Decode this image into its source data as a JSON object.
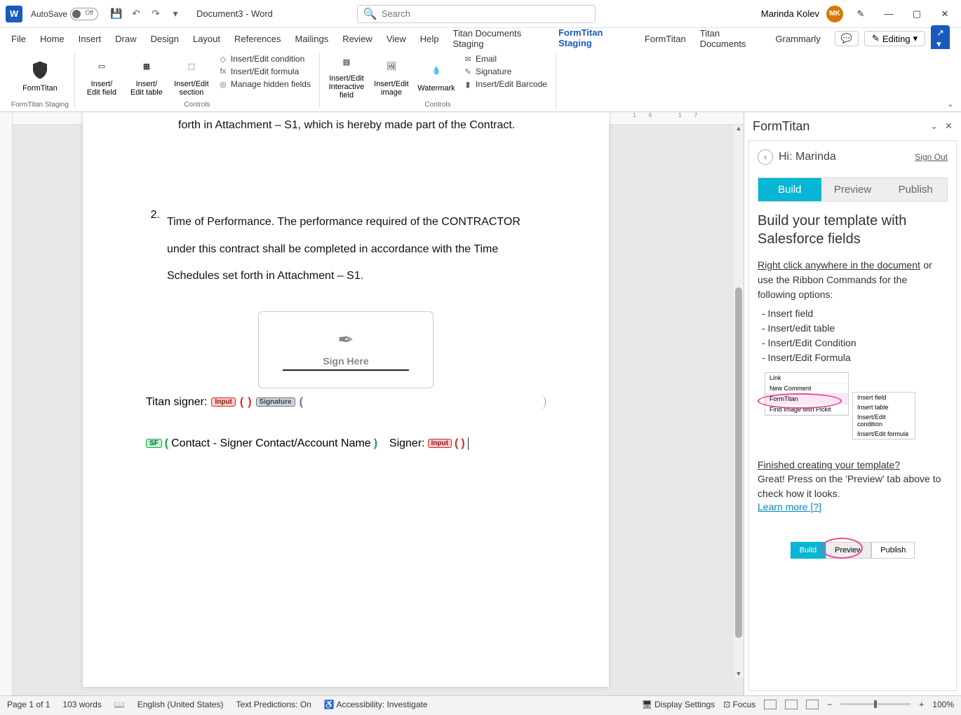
{
  "titlebar": {
    "autosave_label": "AutoSave",
    "autosave_state": "Off",
    "doc_title": "Document3  -  Word",
    "search_placeholder": "Search",
    "username": "Marinda Kolev",
    "avatar_initials": "MK",
    "editing_label": "Editing"
  },
  "tabs": {
    "items": [
      "File",
      "Home",
      "Insert",
      "Draw",
      "Design",
      "Layout",
      "References",
      "Mailings",
      "Review",
      "View",
      "Help",
      "Titan Documents Staging",
      "FormTitan Staging",
      "FormTitan",
      "Titan Documents",
      "Grammarly"
    ],
    "active": "FormTitan Staging"
  },
  "ribbon": {
    "group1_label": "FormTitan Staging",
    "group1_btn": "FormTitan",
    "group2_label": "Controls",
    "group2_btns": [
      "Insert/\nEdit field",
      "Insert/\nEdit table",
      "Insert/Edit\nsection"
    ],
    "group2_items": [
      "Insert/Edit condition",
      "Insert/Edit formula",
      "Manage hidden fields"
    ],
    "group3_label": "Controls",
    "group3_btns": [
      "Insert/Edit\nInteractive field",
      "Insert/Edit\nimage",
      "Watermark"
    ],
    "group3_items": [
      "Email",
      "Signature",
      "Insert/Edit Barcode"
    ]
  },
  "document": {
    "top_fragment": "forth in Attachment – S1, which is hereby made part of the Contract.",
    "list_number": "2.",
    "list_text": "Time of Performance. The performance required of the CONTRACTOR under this contract shall be completed in accordance with the Time Schedules set forth in Attachment – S1.",
    "sign_here": "Sign Here",
    "titan_signer_label": "Titan signer:",
    "tag_input": "Input",
    "tag_signature": "Signature",
    "tag_sf": "SF",
    "sf_field": "Contact - Signer Contact/Account Name",
    "signer_label": "Signer:"
  },
  "panel": {
    "title": "FormTitan",
    "hi": "Hi: Marinda",
    "signout": "Sign Out",
    "tabs": [
      "Build",
      "Preview",
      "Publish"
    ],
    "active_tab": "Build",
    "heading": "Build your template with Salesforce fields",
    "instr_link": "Right click anywhere in the document",
    "instr_cont": "or use the Ribbon Commands for the following options:",
    "bullets": [
      "-  Insert field",
      "-  Insert/edit table",
      "-  Insert/Edit Condition",
      "-  Insert/Edit Formula"
    ],
    "fake_menu": [
      "Link",
      "New Comment",
      "FormTitan",
      "Find Image with Pickit"
    ],
    "fake_sub": [
      "Insert field",
      "Insert table",
      "Insert/Edit condition",
      "Insert/Edit formula"
    ],
    "finished_link": "Finished creating your template?",
    "finished_text": "Great! Press on the 'Preview' tab above to check how it looks.",
    "learn_more": "Learn more [?]",
    "bottom_btns": [
      "Build",
      "Preview",
      "Publish"
    ]
  },
  "statusbar": {
    "page": "Page 1 of 1",
    "words": "103 words",
    "lang": "English (United States)",
    "predictions": "Text Predictions: On",
    "accessibility": "Accessibility: Investigate",
    "display": "Display Settings",
    "focus": "Focus",
    "zoom": "100%"
  }
}
